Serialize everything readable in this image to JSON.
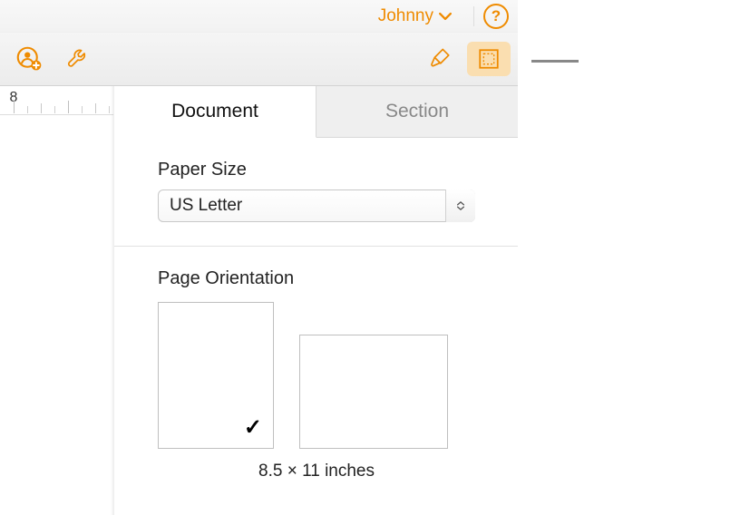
{
  "titlebar": {
    "user_name": "Johnny",
    "help_glyph": "?"
  },
  "panel": {
    "tabs": {
      "document": "Document",
      "section": "Section"
    },
    "paper_size_label": "Paper Size",
    "paper_size_value": "US Letter",
    "orientation_label": "Page Orientation",
    "dimensions": "8.5 × 11 inches",
    "checkmark": "✓"
  },
  "ruler": {
    "number": "8"
  },
  "colors": {
    "accent": "#ef8b00",
    "accent_bg": "#fadeb0"
  }
}
